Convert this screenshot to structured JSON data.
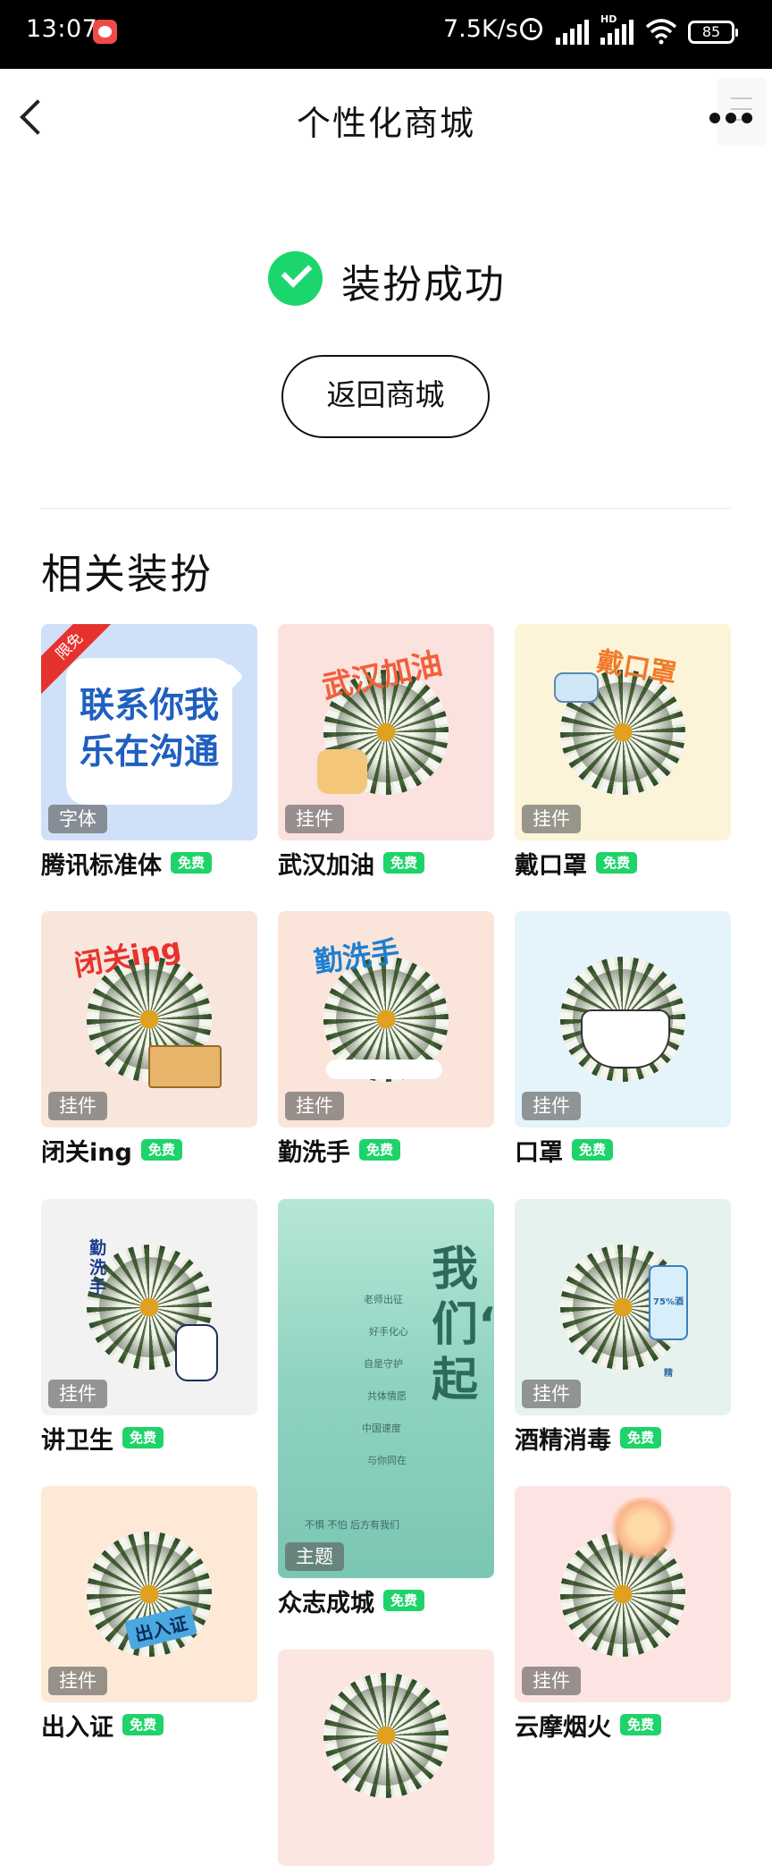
{
  "status_bar": {
    "time": "13:07",
    "network_speed": "7.5K/s",
    "hd": "HD",
    "battery": "85"
  },
  "nav": {
    "title": "个性化商城",
    "back_icon": "chevron-left-icon",
    "more_icon": "more-dots-icon"
  },
  "success": {
    "message": "装扮成功",
    "icon": "check-circle-icon",
    "color": "#1bd66c"
  },
  "return_button": {
    "label": "返回商城"
  },
  "section": {
    "title": "相关装扮"
  },
  "free_label_color": "#1ed36a",
  "items": [
    {
      "name": "腾讯标准体",
      "type": "字体",
      "tag": "免费",
      "limited": "限免",
      "preview_text": "联系你我乐在沟通"
    },
    {
      "name": "武汉加油",
      "type": "挂件",
      "tag": "免费",
      "sticker": "武汉加油"
    },
    {
      "name": "戴口罩",
      "type": "挂件",
      "tag": "免费",
      "sticker": "戴口罩"
    },
    {
      "name": "闭关ing",
      "type": "挂件",
      "tag": "免费",
      "sticker": "闭关ing"
    },
    {
      "name": "勤洗手",
      "type": "挂件",
      "tag": "免费",
      "sticker": "勤洗手"
    },
    {
      "name": "口罩",
      "type": "挂件",
      "tag": "免费"
    },
    {
      "name": "讲卫生",
      "type": "挂件",
      "tag": "免费",
      "sticker": "勤洗手"
    },
    {
      "name": "众志成城",
      "type": "主题",
      "tag": "免费",
      "big_text": "我们“战”一起",
      "lines": [
        "老师出征",
        "好手化心",
        "自是守护",
        "共体情愿",
        "中国速度",
        "与你同在",
        "不惧 不怕 后方有我们"
      ]
    },
    {
      "name": "酒精消毒",
      "type": "挂件",
      "tag": "免费",
      "sticker": "75%酒精"
    },
    {
      "name": "出入证",
      "type": "挂件",
      "tag": "免费",
      "sticker": "出入证"
    },
    {
      "name": "云摩烟火",
      "type": "挂件",
      "tag": "免费"
    }
  ]
}
